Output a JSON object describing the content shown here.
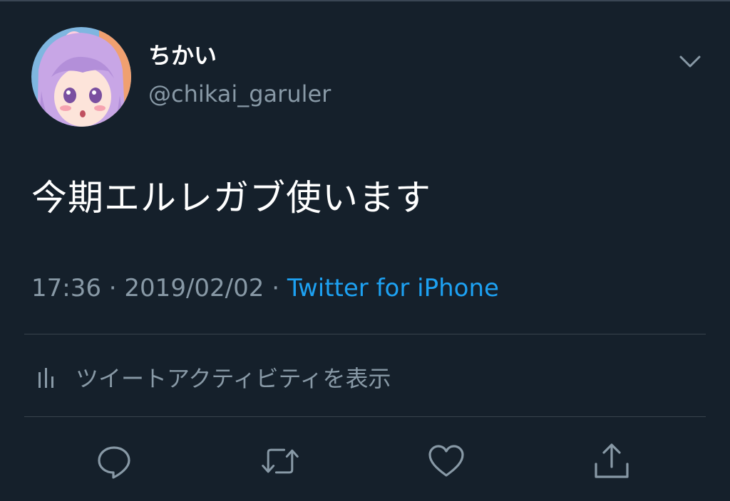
{
  "tweet": {
    "display_name": "ちかい",
    "handle": "@chikai_garuler",
    "text": "今期エルレガブ使います",
    "time": "17:36",
    "separator": " · ",
    "date": "2019/02/02",
    "source": "Twitter for iPhone"
  },
  "activity": {
    "label": "ツイートアクティビティを表示",
    "icon": "bar-chart-icon"
  },
  "actions": [
    {
      "icon": "reply-icon"
    },
    {
      "icon": "retweet-icon"
    },
    {
      "icon": "like-icon"
    },
    {
      "icon": "share-icon"
    }
  ],
  "colors": {
    "background": "#15202b",
    "primary_text": "#ffffff",
    "secondary_text": "#8899a6",
    "link": "#1da1f2",
    "divider": "#38444d"
  }
}
